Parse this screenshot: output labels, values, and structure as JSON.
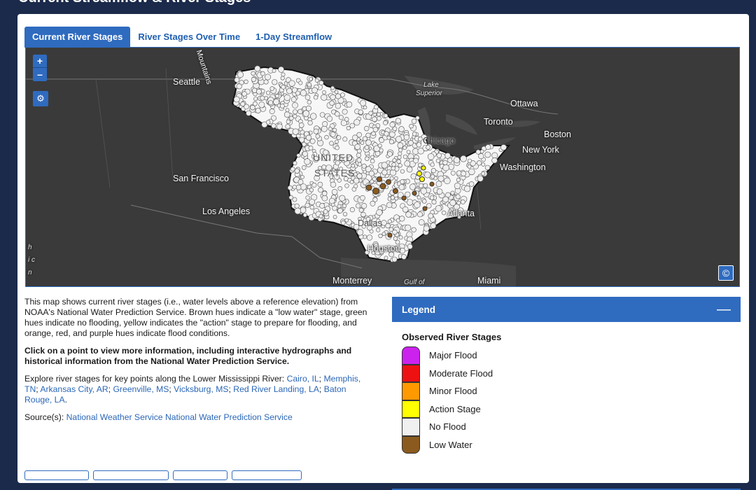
{
  "page": {
    "title": "Current Streamflow & River Stages"
  },
  "tabs": [
    {
      "label": "Current River Stages",
      "active": true
    },
    {
      "label": "River Stages Over Time",
      "active": false
    },
    {
      "label": "1-Day Streamflow",
      "active": false
    }
  ],
  "map": {
    "zoom_in": "+",
    "zoom_out": "–",
    "layers_icon": "layers-icon",
    "attribution_icon": "©",
    "labels": {
      "mountains": "Mountains",
      "seattle": "Seattle",
      "lake_superior_1": "Lake",
      "lake_superior_2": "Superior",
      "ottawa": "Ottawa",
      "toronto": "Toronto",
      "boston": "Boston",
      "new_york": "New York",
      "washington": "Washington",
      "chicago": "Chicago",
      "united": "UNITED",
      "states": "STATES",
      "san_francisco": "San Francisco",
      "los_angeles": "Los Angeles",
      "atlanta": "Atlanta",
      "dallas": "Dallas",
      "houston": "Houston",
      "monterrey": "Monterrey",
      "gulf_of": "Gulf of",
      "miami": "Miami",
      "edge_h": "h",
      "edge_ic": "i c",
      "edge_n": "n"
    },
    "colors": {
      "land": "#3a3a3a",
      "water": "#4a4a4a",
      "basin": "#f7f7f7",
      "no_flood": "#efefef",
      "low_water": "#8b5a1e",
      "action": "#ffff00"
    }
  },
  "description": {
    "p1": "This map shows current river stages (i.e., water levels above a reference elevation) from NOAA's National Water Prediction Service. Brown hues indicate a \"low water\" stage, green hues indicate no flooding, yellow indicates the \"action\" stage to prepare for flooding, and orange, red, and purple hues indicate flood conditions.",
    "p2": "Click on a point to view more information, including interactive hydrographs and historical information from the National Water Prediction Service.",
    "p3_prefix": "Explore river stages for key points along the Lower Mississippi River: ",
    "links": [
      "Cairo, IL",
      "Memphis, TN",
      "Arkansas City, AR",
      "Greenville, MS",
      "Vicksburg, MS",
      "Red River Landing, LA",
      "Baton Rouge, LA"
    ],
    "p3_suffix": ".",
    "source_prefix": "Source(s): ",
    "source_link": "National Weather Service National Water Prediction Service"
  },
  "legend": {
    "header": "Legend",
    "collapse_icon": "—",
    "title": "Observed River Stages",
    "items": [
      {
        "label": "Major Flood",
        "color": "#cc22ee"
      },
      {
        "label": "Moderate Flood",
        "color": "#ee1111"
      },
      {
        "label": "Minor Flood",
        "color": "#ff9900"
      },
      {
        "label": "Action Stage",
        "color": "#ffff00"
      },
      {
        "label": "No Flood",
        "color": "#f0f0f0"
      },
      {
        "label": "Low Water",
        "color": "#8b5a1e"
      }
    ]
  }
}
